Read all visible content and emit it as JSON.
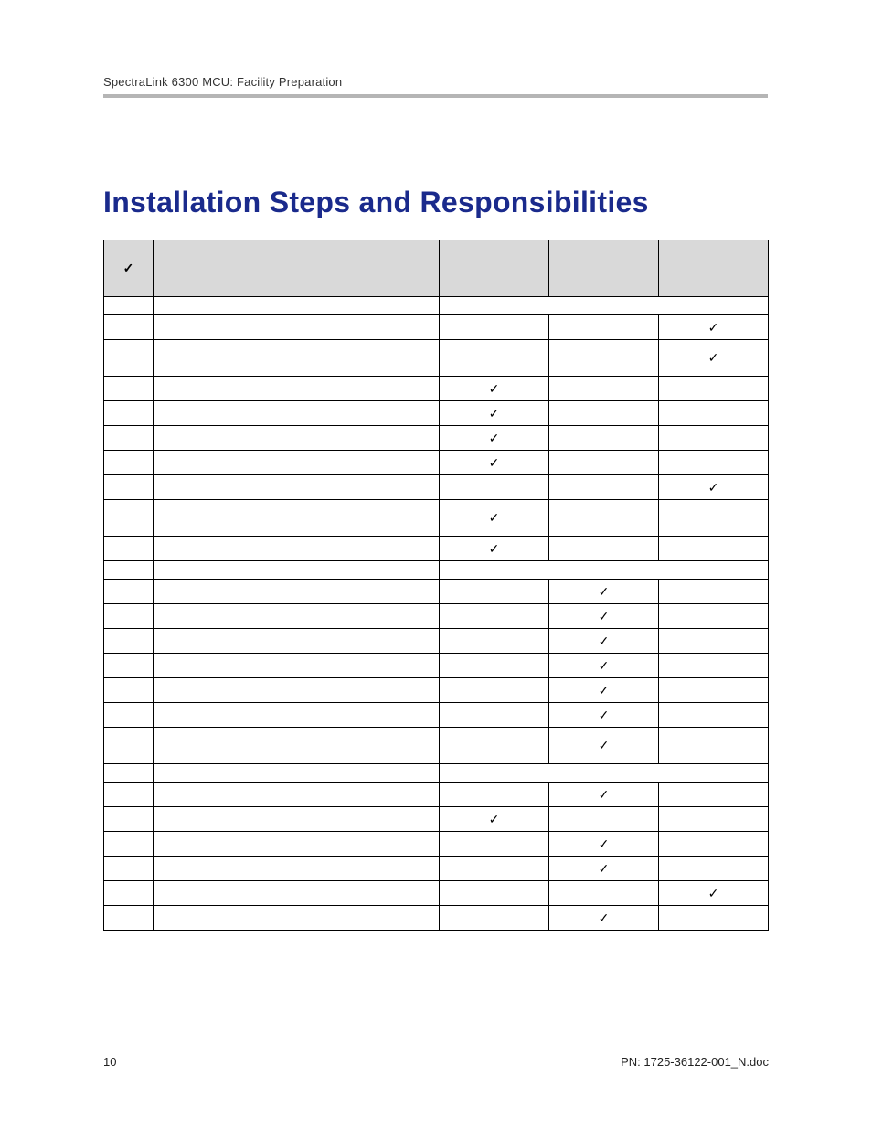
{
  "header": {
    "running": "SpectraLink 6300 MCU: Facility Preparation"
  },
  "title": "Installation Steps and Responsibilities",
  "footer": {
    "page_number": "10",
    "pn": "PN: 1725-36122-001_N.doc"
  },
  "table": {
    "header": {
      "check_symbol": "✓",
      "step": "",
      "colA": "",
      "colB": "",
      "colC": ""
    },
    "rows": [
      {
        "type": "section",
        "step": "",
        "a": "",
        "b": "",
        "c": "",
        "merged": true
      },
      {
        "type": "row",
        "height": "std",
        "step": "",
        "a": "",
        "b": "",
        "c": "✓"
      },
      {
        "type": "row",
        "height": "tall",
        "step": "",
        "a": "",
        "b": "",
        "c": "✓"
      },
      {
        "type": "row",
        "height": "std",
        "step": "",
        "a": "✓",
        "b": "",
        "c": ""
      },
      {
        "type": "row",
        "height": "std",
        "step": "",
        "a": "✓",
        "b": "",
        "c": ""
      },
      {
        "type": "row",
        "height": "std",
        "step": "",
        "a": "✓",
        "b": "",
        "c": ""
      },
      {
        "type": "row",
        "height": "std",
        "step": "",
        "a": "✓",
        "b": "",
        "c": ""
      },
      {
        "type": "row",
        "height": "std",
        "step": "",
        "a": "",
        "b": "",
        "c": "✓"
      },
      {
        "type": "row",
        "height": "tall",
        "step": "",
        "a": "✓",
        "b": "",
        "c": ""
      },
      {
        "type": "row",
        "height": "std",
        "step": "",
        "a": "✓",
        "b": "",
        "c": ""
      },
      {
        "type": "section",
        "step": "",
        "a": "",
        "b": "",
        "c": "",
        "merged": true
      },
      {
        "type": "row",
        "height": "std",
        "step": "",
        "a": "",
        "b": "✓",
        "c": ""
      },
      {
        "type": "row",
        "height": "std",
        "step": "",
        "a": "",
        "b": "✓",
        "c": ""
      },
      {
        "type": "row",
        "height": "std",
        "step": "",
        "a": "",
        "b": "✓",
        "c": ""
      },
      {
        "type": "row",
        "height": "std",
        "step": "",
        "a": "",
        "b": "✓",
        "c": ""
      },
      {
        "type": "row",
        "height": "std",
        "step": "",
        "a": "",
        "b": "✓",
        "c": ""
      },
      {
        "type": "row",
        "height": "std",
        "step": "",
        "a": "",
        "b": "✓",
        "c": ""
      },
      {
        "type": "row",
        "height": "tall",
        "step": "",
        "a": "",
        "b": "✓",
        "c": ""
      },
      {
        "type": "section",
        "step": "",
        "a": "",
        "b": "",
        "c": "",
        "merged": true
      },
      {
        "type": "row",
        "height": "std",
        "step": "",
        "a": "",
        "b": "✓",
        "c": ""
      },
      {
        "type": "row",
        "height": "std",
        "step": "",
        "a": "✓",
        "b": "",
        "c": ""
      },
      {
        "type": "row",
        "height": "std",
        "step": "",
        "a": "",
        "b": "✓",
        "c": ""
      },
      {
        "type": "row",
        "height": "std",
        "step": "",
        "a": "",
        "b": "✓",
        "c": ""
      },
      {
        "type": "row",
        "height": "std",
        "step": "",
        "a": "",
        "b": "",
        "c": "✓"
      },
      {
        "type": "row",
        "height": "std",
        "step": "",
        "a": "",
        "b": "✓",
        "c": ""
      }
    ]
  }
}
